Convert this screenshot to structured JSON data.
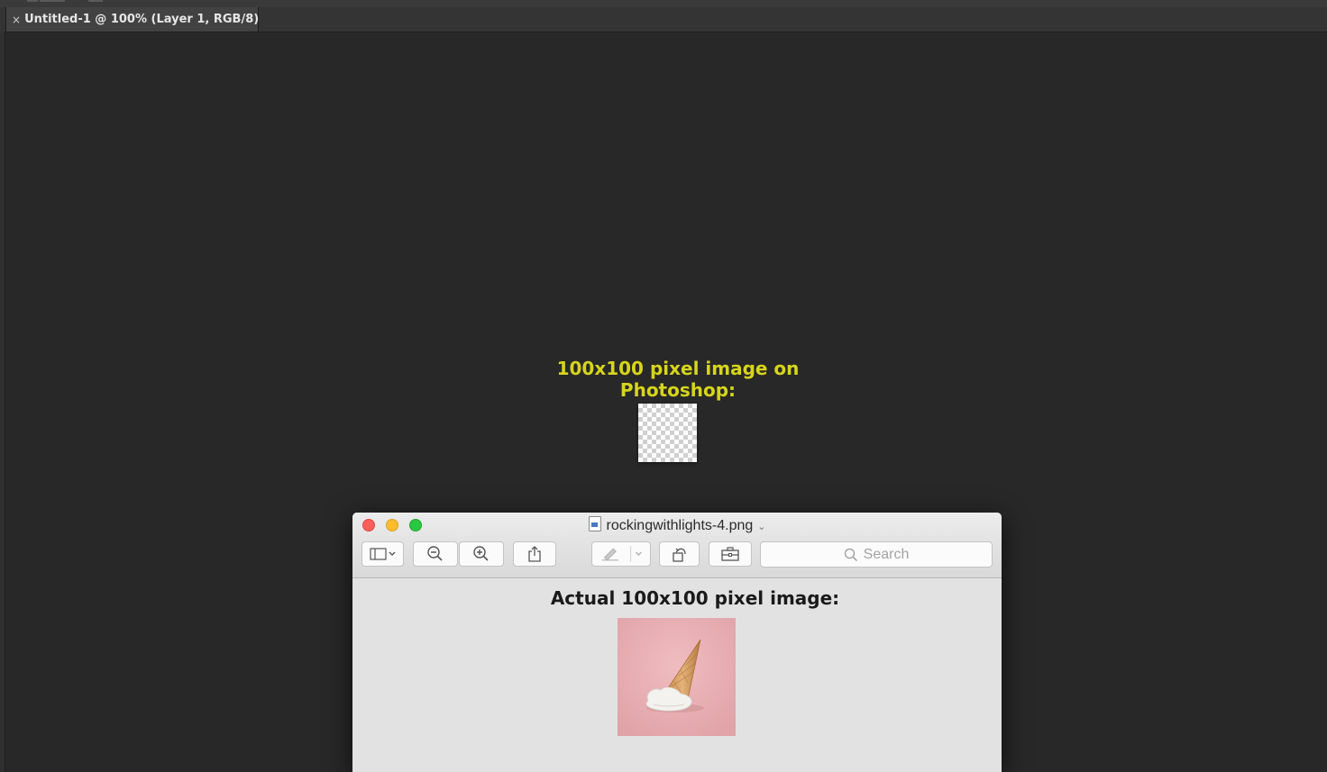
{
  "photoshop": {
    "tab": {
      "close_glyph": "×",
      "title": "Untitled-1 @ 100% (Layer 1, RGB/8)"
    },
    "canvas": {
      "caption": "100x100 pixel image on Photoshop:"
    }
  },
  "preview_window": {
    "title": "rockingwithlights-4.png",
    "toolbar": {
      "buttons": [
        "sidebar-icon",
        "zoom-out-icon",
        "zoom-in-icon",
        "share-icon",
        "markup-icon",
        "rotate-icon",
        "toolbox-icon"
      ],
      "search_placeholder": "Search"
    },
    "content": {
      "heading": "Actual 100x100 pixel image:"
    }
  },
  "colors": {
    "ps_background": "#282828",
    "caption": "#d7d51c",
    "photo_background": "#e8b1b5"
  }
}
